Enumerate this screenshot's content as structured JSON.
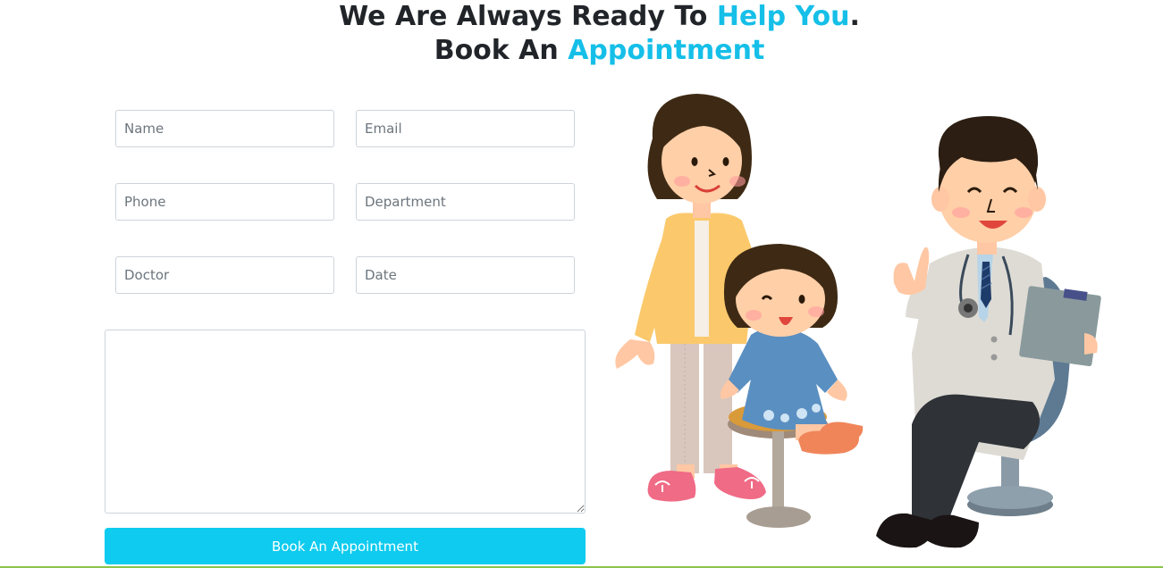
{
  "heading": {
    "line1_prefix": "We Are Always Ready To ",
    "line1_highlight": "Help You",
    "line1_suffix": ".",
    "line2_prefix": "Book An ",
    "line2_highlight": "Appointment"
  },
  "form": {
    "name": {
      "placeholder": "Name",
      "value": ""
    },
    "email": {
      "placeholder": "Email",
      "value": ""
    },
    "phone": {
      "placeholder": "Phone",
      "value": ""
    },
    "department": {
      "placeholder": "Department",
      "value": ""
    },
    "doctor": {
      "placeholder": "Doctor",
      "value": ""
    },
    "date": {
      "placeholder": "Date",
      "value": ""
    },
    "message": {
      "value": ""
    },
    "submit_label": "Book An Appointment"
  },
  "colors": {
    "accent": "#15bfe8",
    "button": "#0ecbef",
    "bottom_line": "#8bc34a"
  },
  "illustration": {
    "icon": "doctor-family-illustration"
  }
}
